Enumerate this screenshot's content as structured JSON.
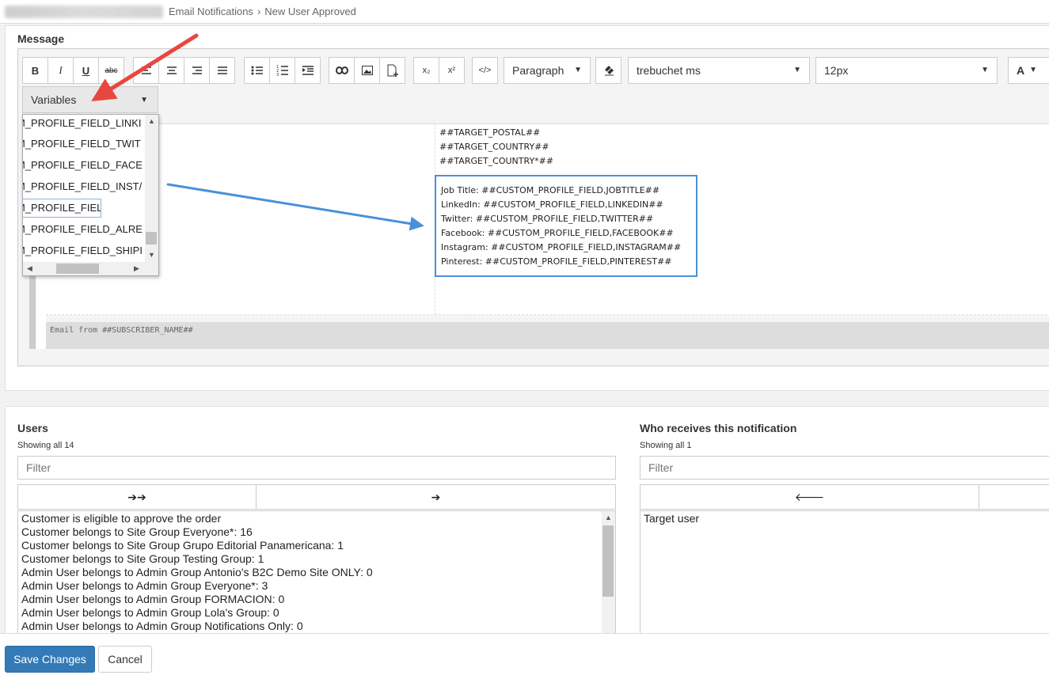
{
  "breadcrumb": {
    "items": [
      "Email Notifications",
      "New User Approved"
    ],
    "separator": "›"
  },
  "message": {
    "label": "Message",
    "toolbar": {
      "bold": "B",
      "italic": "I",
      "underline": "U",
      "strike": "abc",
      "subscript": "x₂",
      "superscript": "x²",
      "code": "</>",
      "paragraph": "Paragraph",
      "font_family": "trebuchet ms",
      "font_size": "12px",
      "font_color": "A"
    },
    "variables": {
      "label": "Variables",
      "items": [
        "M_PROFILE_FIELD_LINKI",
        "M_PROFILE_FIELD_TWIT",
        "M_PROFILE_FIELD_FACE",
        "M_PROFILE_FIELD_INST/",
        "M_PROFILE_FIELD_PINTI",
        "M_PROFILE_FIELD_ALRE",
        "M_PROFILE_FIELD_SHIPI"
      ],
      "selected_index": 4
    },
    "content": {
      "target_lines": [
        "##TARGET_POSTAL##",
        "##TARGET_COUNTRY##",
        "##TARGET_COUNTRY*##"
      ],
      "custom_fields": [
        "Job Title: ##CUSTOM_PROFILE_FIELD,JOBTITLE##",
        "LinkedIn: ##CUSTOM_PROFILE_FIELD,LINKEDIN##",
        "Twitter: ##CUSTOM_PROFILE_FIELD,TWITTER##",
        "Facebook: ##CUSTOM_PROFILE_FIELD,FACEBOOK##",
        "Instagram: ##CUSTOM_PROFILE_FIELD,INSTAGRAM##",
        "Pinterest: ##CUSTOM_PROFILE_FIELD,PINTEREST##"
      ],
      "footer": "Email from ##SUBSCRIBER_NAME##"
    }
  },
  "users": {
    "title": "Users",
    "showing": "Showing all 14",
    "filter_placeholder": "Filter",
    "move_all": "➔➔",
    "move_one": "➔",
    "items": [
      "Customer is eligible to approve the order",
      "Customer belongs to Site Group Everyone*: 16",
      "Customer belongs to Site Group Grupo Editorial Panamericana: 1",
      "Customer belongs to Site Group Testing Group: 1",
      "Admin User belongs to Admin Group Antonio's B2C Demo Site ONLY: 0",
      "Admin User belongs to Admin Group Everyone*: 3",
      "Admin User belongs to Admin Group FORMACION: 0",
      "Admin User belongs to Admin Group Lola's Group: 0",
      "Admin User belongs to Admin Group Notifications Only: 0"
    ]
  },
  "receivers": {
    "title": "Who receives this notification",
    "showing": "Showing all 1",
    "filter_placeholder": "Filter",
    "remove_one": "🡐",
    "items": [
      "Target user"
    ]
  },
  "actions": {
    "save": "Save Changes",
    "cancel": "Cancel"
  },
  "colors": {
    "primary": "#337ab7",
    "annotation_red": "#e8473f",
    "annotation_blue": "#4a90d9"
  }
}
